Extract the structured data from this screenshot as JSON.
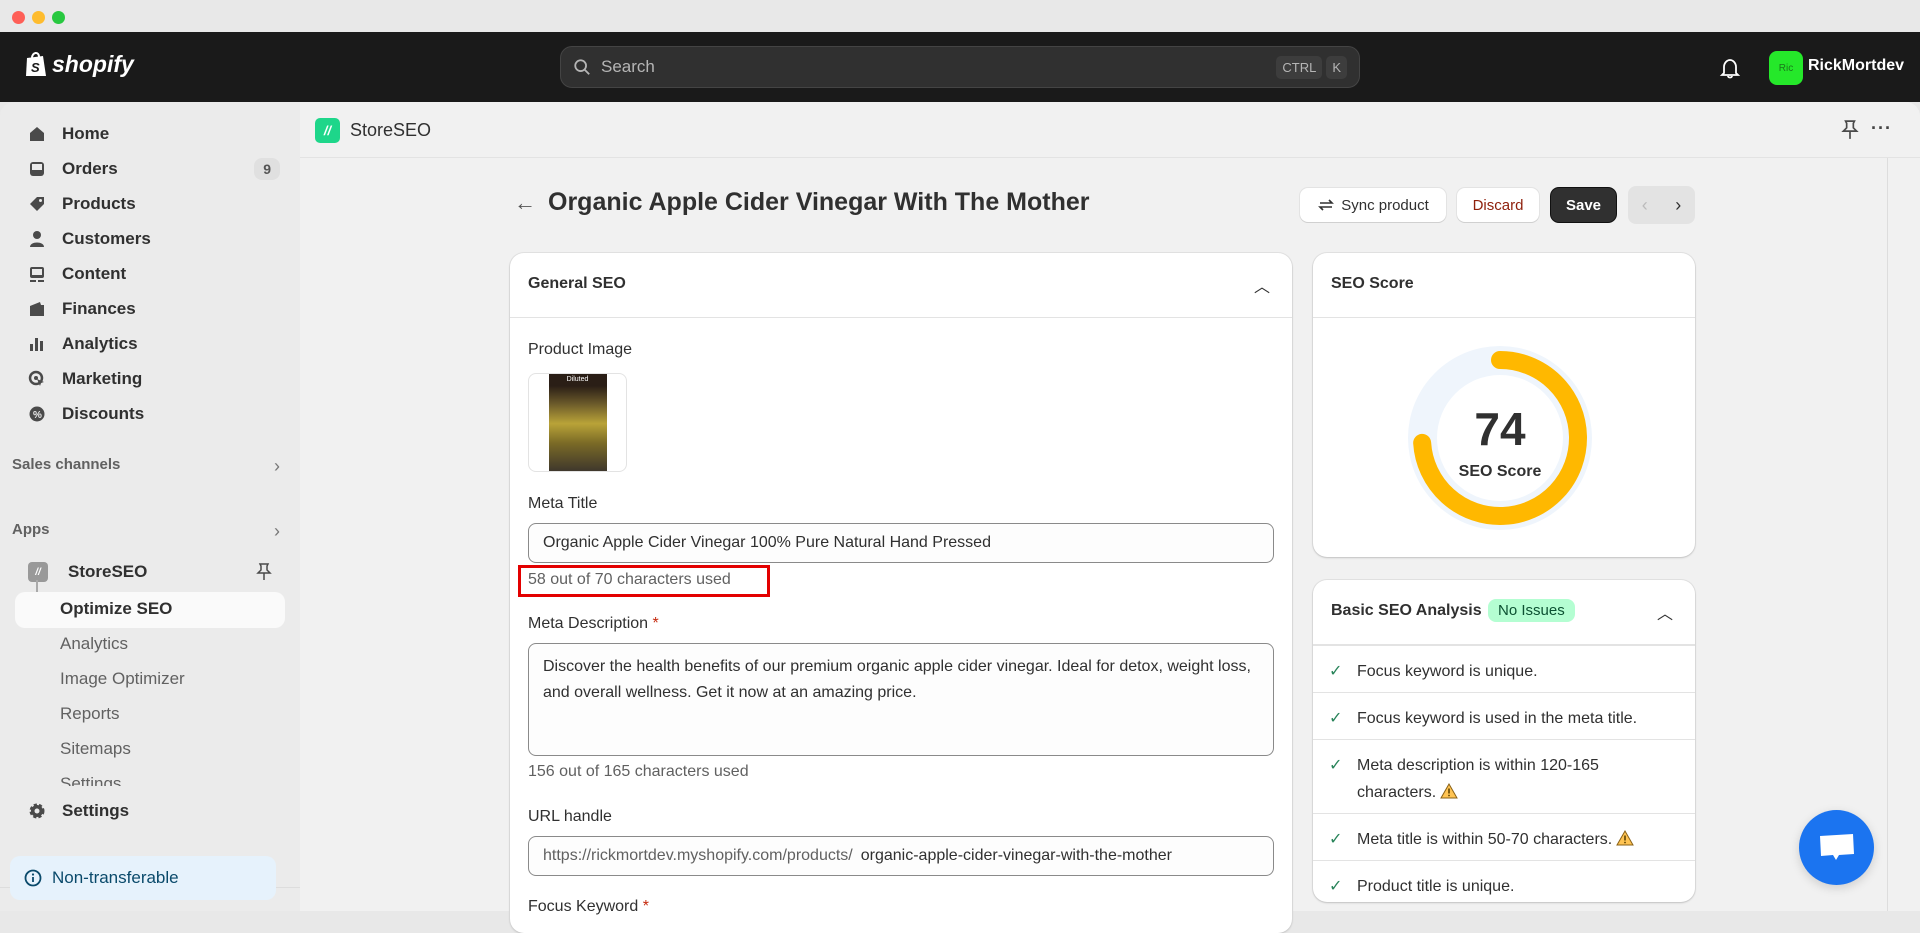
{
  "window": {
    "controls": [
      "close",
      "minimize",
      "maximize"
    ]
  },
  "topbar": {
    "brand": "shopify",
    "search_placeholder": "Search",
    "shortcut_keys": [
      "CTRL",
      "K"
    ],
    "avatar_initials": "Ric",
    "username": "RickMortdev"
  },
  "sidebar": {
    "items": [
      {
        "label": "Home",
        "icon": "home-icon"
      },
      {
        "label": "Orders",
        "icon": "orders-icon",
        "badge": "9"
      },
      {
        "label": "Products",
        "icon": "tag-icon"
      },
      {
        "label": "Customers",
        "icon": "person-icon"
      },
      {
        "label": "Content",
        "icon": "content-icon"
      },
      {
        "label": "Finances",
        "icon": "wallet-icon"
      },
      {
        "label": "Analytics",
        "icon": "bar-chart-icon"
      },
      {
        "label": "Marketing",
        "icon": "target-icon"
      },
      {
        "label": "Discounts",
        "icon": "discount-icon"
      }
    ],
    "sales_channels_label": "Sales channels",
    "apps_label": "Apps",
    "app": {
      "name": "StoreSEO",
      "subitems": [
        "Optimize SEO",
        "Analytics",
        "Image Optimizer",
        "Reports",
        "Sitemaps",
        "Settings"
      ],
      "active_subitem": "Optimize SEO"
    },
    "settings_label": "Settings",
    "non_transferable_label": "Non-transferable"
  },
  "app_header": {
    "name": "StoreSEO"
  },
  "page": {
    "title": "Organic Apple Cider Vinegar With The Mother",
    "buttons": {
      "sync": "Sync product",
      "discard": "Discard",
      "save": "Save"
    }
  },
  "general_seo": {
    "title": "General SEO",
    "product_image_label": "Product Image",
    "product_image_caption": "Diluted",
    "meta_title_label": "Meta Title",
    "meta_title_value": "Organic Apple Cider Vinegar 100% Pure Natural Hand Pressed",
    "meta_title_counter": "58 out of 70 characters used",
    "meta_description_label": "Meta Description",
    "required_marker": "*",
    "meta_description_value": "Discover the health benefits of our premium organic apple cider vinegar. Ideal for detox, weight loss, and overall wellness. Get it now at an amazing price.",
    "meta_description_counter": "156 out of 165 characters used",
    "url_handle_label": "URL handle",
    "url_prefix": "https://rickmortdev.myshopify.com/products/",
    "url_handle_value": "organic-apple-cider-vinegar-with-the-mother",
    "focus_keyword_label": "Focus Keyword"
  },
  "seo_score": {
    "title": "SEO Score",
    "value": "74",
    "percent": 74,
    "caption": "SEO Score",
    "color": "#ffb800",
    "track_color": "#eff5fc"
  },
  "basic_analysis": {
    "title": "Basic SEO Analysis",
    "badge": "No Issues",
    "checks": [
      {
        "text": "Focus keyword is unique.",
        "warning": false
      },
      {
        "text": "Focus keyword is used in the meta title.",
        "warning": false
      },
      {
        "text": "Meta description is within 120-165 characters.",
        "warning": true
      },
      {
        "text": "Meta title is within 50-70 characters.",
        "warning": true
      },
      {
        "text": "Product title is unique.",
        "warning": false
      }
    ]
  },
  "chat": {
    "icon": "chat-icon"
  }
}
